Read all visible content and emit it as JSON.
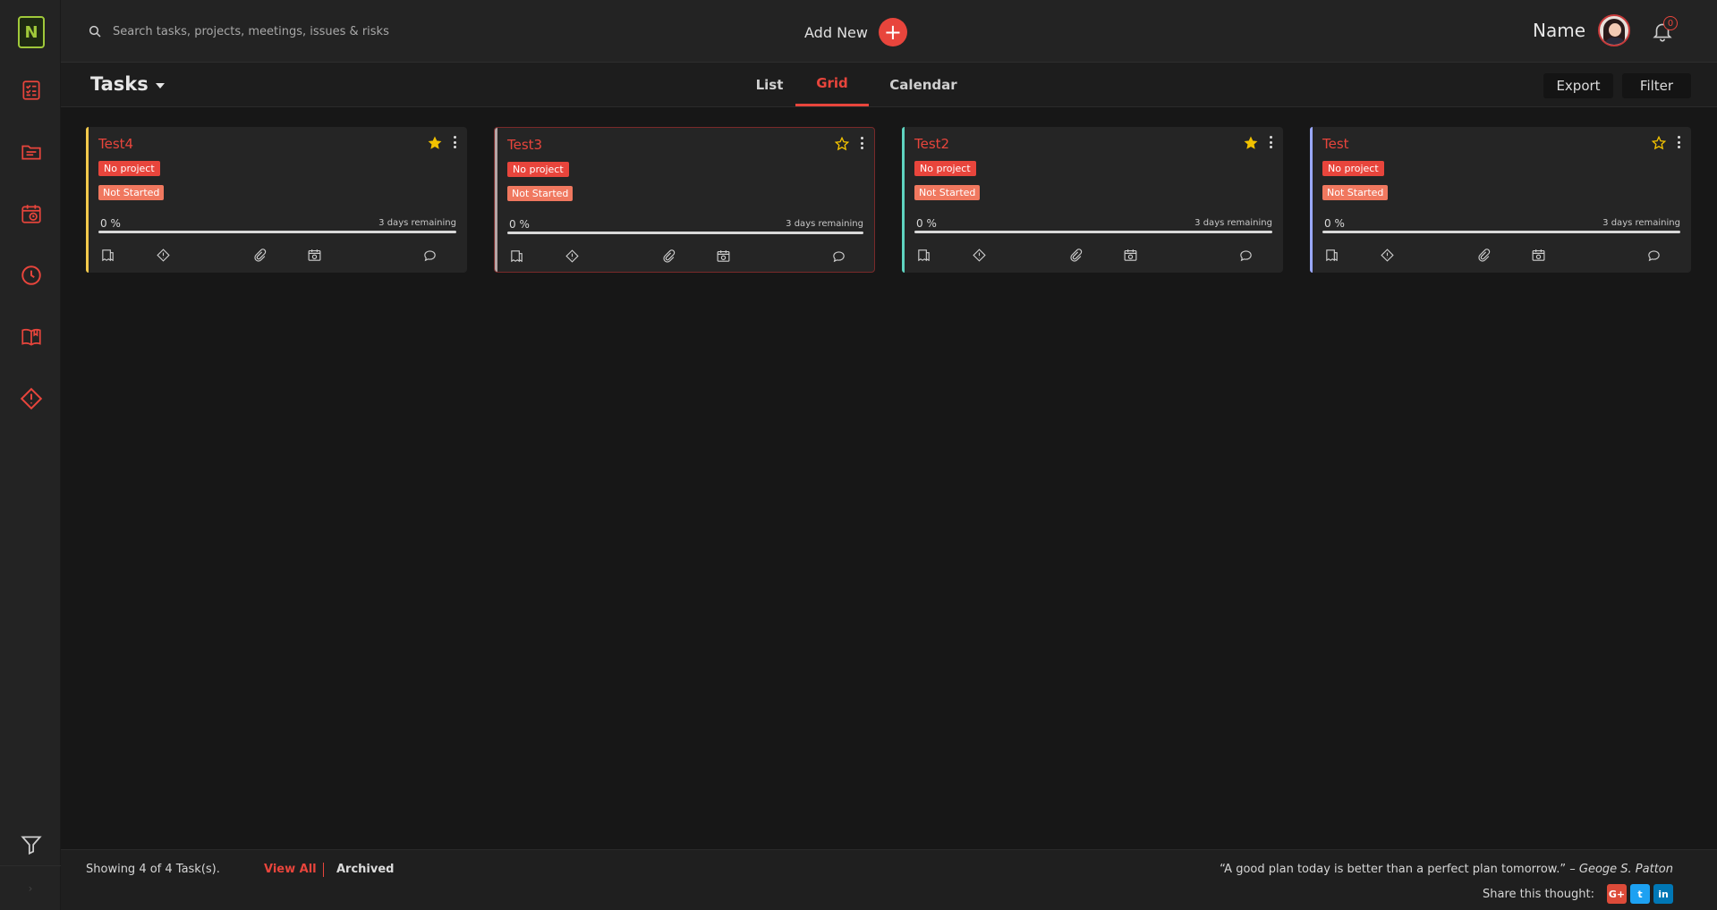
{
  "app": {
    "logo_text": "N",
    "accent_color": "#e8453c"
  },
  "sidebar": {
    "items": [
      {
        "name": "tasks",
        "icon": "checklist-icon"
      },
      {
        "name": "projects",
        "icon": "folder-icon"
      },
      {
        "name": "meetings",
        "icon": "calendar-clock-icon"
      },
      {
        "name": "timesheet",
        "icon": "clock-icon"
      },
      {
        "name": "notes",
        "icon": "book-icon"
      },
      {
        "name": "issues",
        "icon": "warning-diamond-icon"
      }
    ],
    "bottom_icon": "filter-icon",
    "collapse_glyph": "›"
  },
  "header": {
    "search_placeholder": "Search tasks, projects, meetings, issues & risks",
    "add_new_label": "Add New",
    "add_new_glyph": "+",
    "user_name": "Name",
    "notifications_count": "0"
  },
  "subheader": {
    "title": "Tasks",
    "tabs": [
      {
        "label": "List",
        "active": false
      },
      {
        "label": "Grid",
        "active": true
      },
      {
        "label": "Calendar",
        "active": false
      }
    ],
    "export_label": "Export",
    "filter_label": "Filter"
  },
  "cards": [
    {
      "title": "Test4",
      "accent": "#f2c94c",
      "starred": true,
      "selected": false,
      "project": "No project",
      "status": "Not Started",
      "progress_label": "0 %",
      "progress": 0,
      "remaining": "3 days remaining"
    },
    {
      "title": "Test3",
      "accent": "#b5a6a6",
      "starred": false,
      "selected": true,
      "project": "No project",
      "status": "Not Started",
      "progress_label": "0 %",
      "progress": 0,
      "remaining": "3 days remaining"
    },
    {
      "title": "Test2",
      "accent": "#5fd4c0",
      "starred": true,
      "selected": false,
      "project": "No project",
      "status": "Not Started",
      "progress_label": "0 %",
      "progress": 0,
      "remaining": "3 days remaining"
    },
    {
      "title": "Test",
      "accent": "#9aa8ff",
      "starred": false,
      "selected": false,
      "project": "No project",
      "status": "Not Started",
      "progress_label": "0 %",
      "progress": 0,
      "remaining": "3 days remaining"
    }
  ],
  "card_actions": [
    "notes-icon",
    "issue-icon",
    "attachment-icon",
    "meeting-icon",
    "comment-icon"
  ],
  "footer": {
    "showing": "Showing 4 of 4 Task(s).",
    "view_all": "View All",
    "archived": "Archived",
    "quote": "“A good plan today is better than a perfect plan tomorrow.” –",
    "quote_author": "Geoge S. Patton",
    "share_label": "Share this thought:",
    "social": [
      {
        "name": "google-plus",
        "glyph": "G+",
        "color": "#dd4b39"
      },
      {
        "name": "twitter",
        "glyph": "t",
        "color": "#1da1f2"
      },
      {
        "name": "linkedin",
        "glyph": "in",
        "color": "#0077b5"
      }
    ]
  }
}
